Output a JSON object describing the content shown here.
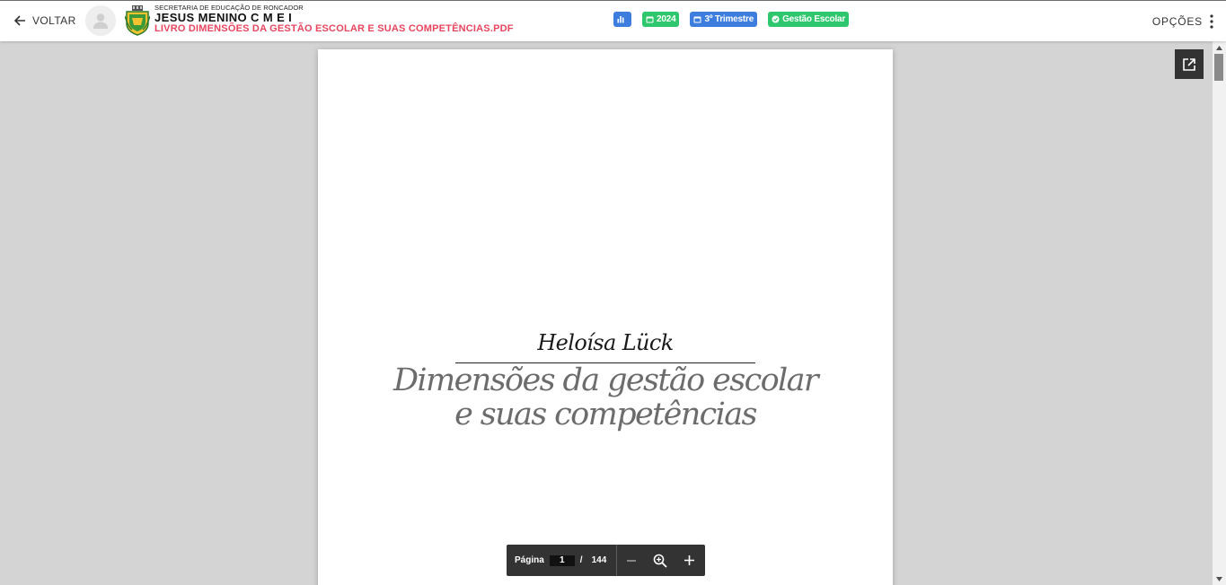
{
  "header": {
    "back_label": "VOLTAR",
    "secretariat": "SECRETARIA DE EDUCAÇÃO DE RONCADOR",
    "school_name": "JESUS MENINO C M E I",
    "file_name": "LIVRO DIMENSÕES DA GESTÃO ESCOLAR E SUAS COMPETÊNCIAS.PDF",
    "options_label": "OPÇÕES",
    "badges": [
      {
        "label": "",
        "icon": "bar-chart-icon",
        "color": "#3d7ddd"
      },
      {
        "label": "2024",
        "icon": "calendar-icon",
        "color": "#2fc76e"
      },
      {
        "label": "3º Trimestre",
        "icon": "calendar-icon",
        "color": "#3d7ddd"
      },
      {
        "label": "Gestão Escolar",
        "icon": "check-circle-icon",
        "color": "#2fc76e"
      }
    ]
  },
  "document": {
    "author": "Heloísa Lück",
    "title_line1": "Dimensões da gestão escolar",
    "title_line2": "e suas competências"
  },
  "toolbar": {
    "page_label": "Página",
    "current_page": "1",
    "separator": "/",
    "total_pages": "144"
  },
  "colors": {
    "accent_red": "#e8455f",
    "toolbar_bg": "#333333",
    "viewer_bg": "#d4d4d4"
  }
}
